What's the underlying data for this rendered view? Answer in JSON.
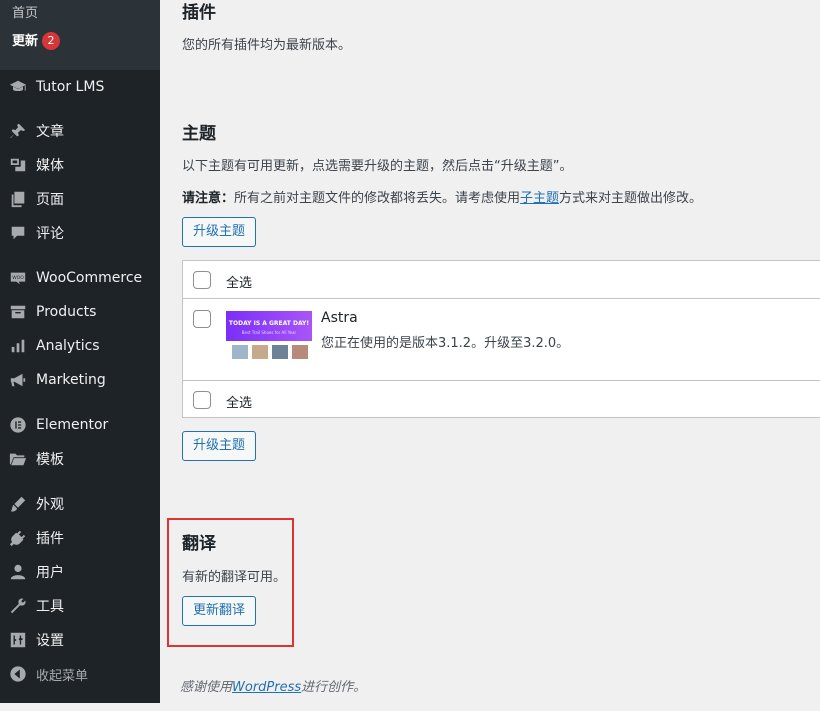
{
  "sidebar": {
    "submenu": [
      {
        "label": "首页"
      },
      {
        "label": "更新",
        "badge": "2"
      }
    ],
    "items": [
      {
        "label": "Tutor LMS",
        "icon": "mortarboard-icon"
      },
      {
        "label": "文章",
        "icon": "pushpin-icon"
      },
      {
        "label": "媒体",
        "icon": "media-icon"
      },
      {
        "label": "页面",
        "icon": "page-icon"
      },
      {
        "label": "评论",
        "icon": "comment-icon"
      },
      {
        "label": "WooCommerce",
        "icon": "woo-icon"
      },
      {
        "label": "Products",
        "icon": "archive-icon"
      },
      {
        "label": "Analytics",
        "icon": "bar-chart-icon"
      },
      {
        "label": "Marketing",
        "icon": "megaphone-icon"
      },
      {
        "label": "Elementor",
        "icon": "elementor-icon"
      },
      {
        "label": "模板",
        "icon": "folder-icon"
      },
      {
        "label": "外观",
        "icon": "brush-icon"
      },
      {
        "label": "插件",
        "icon": "plugin-icon"
      },
      {
        "label": "用户",
        "icon": "user-icon"
      },
      {
        "label": "工具",
        "icon": "wrench-icon"
      },
      {
        "label": "设置",
        "icon": "sliders-icon"
      },
      {
        "label": "收起菜单",
        "icon": "collapse-icon"
      }
    ]
  },
  "plugins": {
    "title": "插件",
    "message": "您的所有插件均为最新版本。"
  },
  "themes": {
    "title": "主题",
    "message": "以下主题有可用更新，点选需要升级的主题，然后点击“升级主题”。",
    "notice_label": "请注意：",
    "notice_text": "所有之前对主题文件的修改都将丢失。请考虑使用",
    "notice_link": "子主题",
    "notice_tail": "方式来对主题做出修改。",
    "button_label": "升级主题",
    "select_all_label": "全选",
    "theme": {
      "name": "Astra",
      "description": "您正在使用的是版本3.1.2。升级至3.2.0。",
      "thumb_title": "TODAY IS A GREAT DAY!",
      "thumb_subtitle": "Best Trail Shoes for All Year"
    }
  },
  "translations": {
    "title": "翻译",
    "message": "有新的翻译可用。",
    "button_label": "更新翻译"
  },
  "footer": {
    "prefix": "感谢使用",
    "link": "WordPress",
    "suffix": "进行创作。"
  },
  "colors": {
    "sidebar_bg": "#1d2327",
    "accent": "#2271b1",
    "badge": "#d63638",
    "highlight_border": "#e0322e"
  }
}
